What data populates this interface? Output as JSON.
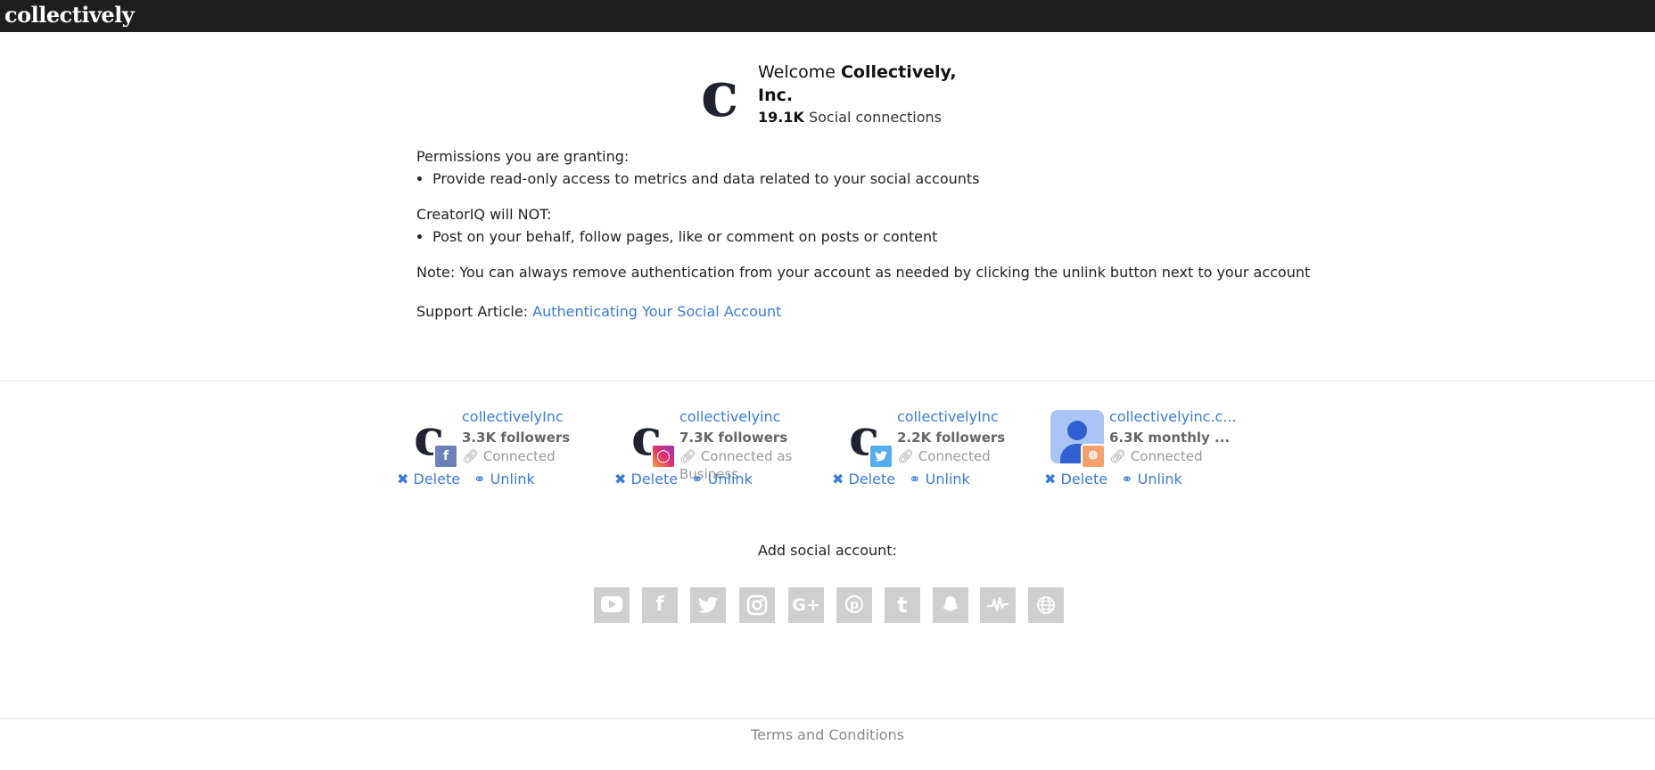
{
  "brand": "collectively",
  "welcome": {
    "prefix": "Welcome ",
    "name": "Collectively, Inc.",
    "connections_count": "19.1K",
    "connections_label": " Social connections"
  },
  "permissions": {
    "granting_label": "Permissions you are granting:",
    "granting_items": [
      "Provide read-only access to metrics and data related to your social accounts"
    ],
    "not_label": "CreatorIQ will NOT:",
    "not_items": [
      "Post on your behalf, follow pages, like or comment on posts or content"
    ],
    "note": "Note: You can always remove authentication from your account as needed by clicking the unlink button next to your account",
    "support_prefix": "Support Article: ",
    "support_link": "Authenticating Your Social Account"
  },
  "accounts": [
    {
      "name": "collectivelyInc",
      "followers": "3.3K followers",
      "status": "Connected",
      "badge_icon": "facebook-icon",
      "badge_color": "#6a82b8"
    },
    {
      "name": "collectivelyinc",
      "followers": "7.3K followers",
      "status": "Connected as Business",
      "badge_icon": "instagram-icon",
      "badge_color": "#e1306c"
    },
    {
      "name": "collectivelyInc",
      "followers": "2.2K followers",
      "status": "Connected",
      "badge_icon": "twitter-icon",
      "badge_color": "#55acee"
    },
    {
      "name": "collectivelyinc.c...",
      "followers": "6.3K monthly ...",
      "status": "Connected",
      "badge_icon": "globe-icon",
      "badge_color": "#f4a06b"
    }
  ],
  "actions": {
    "delete": "Delete",
    "unlink": "Unlink"
  },
  "add_social_label": "Add social account:",
  "social_icons": [
    "youtube-icon",
    "facebook-icon",
    "twitter-icon",
    "instagram-icon",
    "google-plus-icon",
    "pinterest-icon",
    "tumblr-icon",
    "snapchat-icon",
    "musically-icon",
    "globe-icon"
  ],
  "footer": {
    "terms": "Terms and Conditions"
  },
  "colors": {
    "link": "#3a7bd5",
    "topbar": "#1e1e1e",
    "social_icon_bg": "#cfcfcf"
  }
}
